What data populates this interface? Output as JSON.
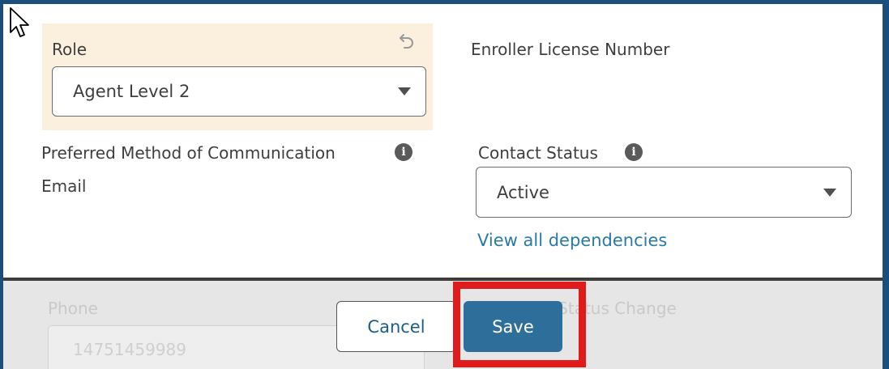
{
  "role": {
    "label": "Role",
    "selected": "Agent Level 2"
  },
  "enroller_license": {
    "label": "Enroller License Number"
  },
  "communication": {
    "label": "Preferred Method of Communication",
    "value": "Email"
  },
  "contact_status": {
    "label": "Contact Status",
    "selected": "Active",
    "dependencies_link": "View all dependencies"
  },
  "background_form": {
    "phone_label": "Phone",
    "phone_value": "14751459989",
    "status_change_label": "Contact Status Change"
  },
  "actions": {
    "cancel_label": "Cancel",
    "save_label": "Save"
  },
  "colors": {
    "frame": "#1b4e7a",
    "role_highlight": "#fbf0dd",
    "save_button": "#2d6f9a",
    "link": "#2a7aa8",
    "annotation_box": "#e01b1b"
  }
}
